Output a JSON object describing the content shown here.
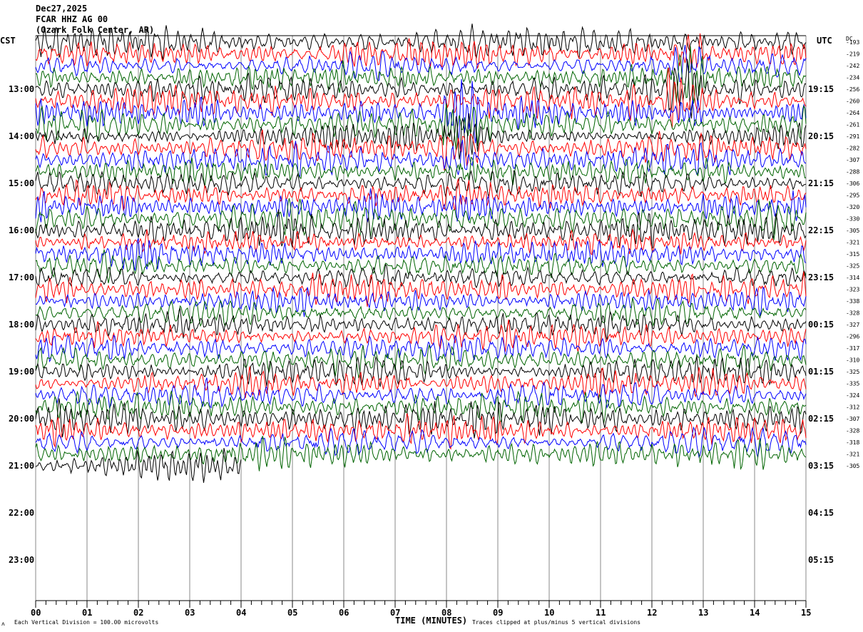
{
  "header": {
    "date": "Dec27,2025",
    "station": "FCAR HHZ AG 00",
    "location": "(Ozark Folk Center, AR)"
  },
  "left_axis_title": "CST",
  "right_axis_title": "UTC",
  "dc_title": "DC",
  "footer": {
    "scale_note": "Each Vertical Division =  100.00 microvolts",
    "xlabel": "TIME (MINUTES)",
    "clip_note": "Traces clipped at plus/minus 5 vertical divisions"
  },
  "chart_data": {
    "type": "line",
    "subtype": "helicorder",
    "xlabel": "TIME (MINUTES)",
    "xlim": [
      0,
      15
    ],
    "x_ticks": [
      "00",
      "01",
      "02",
      "03",
      "04",
      "05",
      "06",
      "07",
      "08",
      "09",
      "10",
      "11",
      "12",
      "13",
      "14",
      "15"
    ],
    "left_labels": [
      "13:00",
      "14:00",
      "15:00",
      "16:00",
      "17:00",
      "18:00",
      "19:00",
      "20:00",
      "21:00",
      "22:00",
      "23:00"
    ],
    "right_labels": [
      "19:15",
      "20:15",
      "21:15",
      "22:15",
      "23:15",
      "00:15",
      "01:15",
      "02:15",
      "03:15",
      "04:15",
      "05:15"
    ],
    "trace_colors": [
      "#000000",
      "#ff0000",
      "#0000ff",
      "#006400"
    ],
    "lines_per_hour": 4,
    "first_line": "12:00",
    "last_line": "21:00",
    "last_line_end_minute": 4,
    "dc_offsets": [
      "-193",
      "-219",
      "-242",
      "-234",
      "-256",
      "-260",
      "-264",
      "-261",
      "-291",
      "-282",
      "-307",
      "-288",
      "-306",
      "-295",
      "-320",
      "-330",
      "-305",
      "-321",
      "-315",
      "-325",
      "-314",
      "-323",
      "-338",
      "-328",
      "-327",
      "-296",
      "-317",
      "-310",
      "-325",
      "-335",
      "-324",
      "-312",
      "-307",
      "-328",
      "-318",
      "-321",
      "-305"
    ],
    "grid": true
  }
}
